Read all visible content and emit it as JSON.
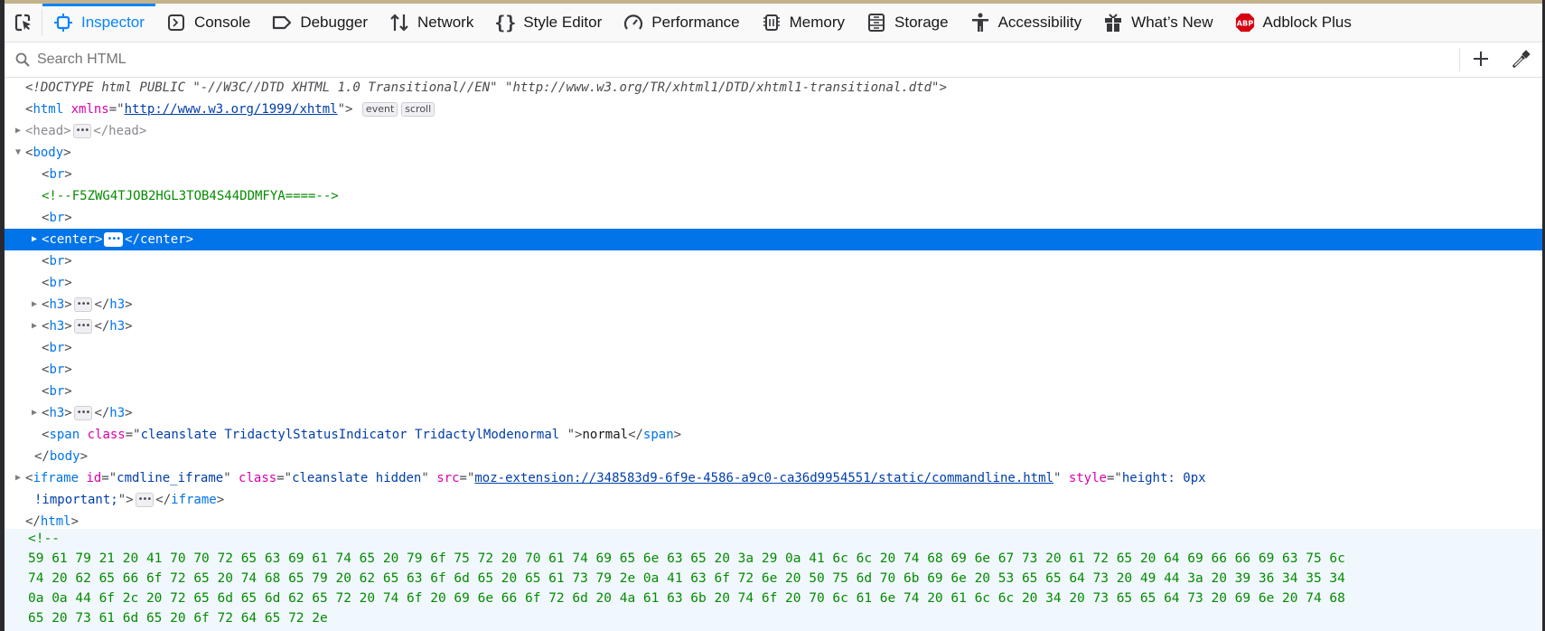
{
  "toolbar": {
    "tabs": [
      {
        "label": "Inspector",
        "icon": "inspector-icon",
        "selected": true
      },
      {
        "label": "Console",
        "icon": "console-icon"
      },
      {
        "label": "Debugger",
        "icon": "debugger-icon"
      },
      {
        "label": "Network",
        "icon": "network-icon"
      },
      {
        "label": "Style Editor",
        "icon": "braces-icon"
      },
      {
        "label": "Performance",
        "icon": "gauge-icon"
      },
      {
        "label": "Memory",
        "icon": "memory-chip-icon"
      },
      {
        "label": "Storage",
        "icon": "storage-icon"
      },
      {
        "label": "Accessibility",
        "icon": "accessibility-icon"
      },
      {
        "label": "What’s New",
        "icon": "gift-icon"
      },
      {
        "label": "Adblock Plus",
        "icon": "abp-icon"
      }
    ],
    "abp_logo_text": "ABP",
    "accent": "#0a84ff"
  },
  "search": {
    "placeholder": "Search HTML"
  },
  "tree": [
    {
      "depth": 0,
      "tokens": [
        [
          "doc",
          "<!DOCTYPE html PUBLIC \"-//W3C//DTD XHTML 1.0 Transitional//EN\" \"http://www.w3.org/TR/xhtml1/DTD/xhtml1-transitional.dtd\">"
        ]
      ]
    },
    {
      "depth": 0,
      "tokens": [
        [
          "p",
          "<"
        ],
        [
          "tag",
          "html"
        ],
        [
          "p",
          " "
        ],
        [
          "attr",
          "xmlns"
        ],
        [
          "p",
          "=\""
        ],
        [
          "link",
          "http://www.w3.org/1999/xhtml"
        ],
        [
          "p",
          "\">"
        ],
        [
          "p",
          " "
        ],
        [
          "badge",
          "event"
        ],
        [
          "badge",
          "scroll"
        ]
      ]
    },
    {
      "depth": 0,
      "expander": "collapsed",
      "tokens": [
        [
          "dim",
          "<head>"
        ],
        [
          "dots",
          "•••"
        ],
        [
          "dim",
          "</head>"
        ]
      ]
    },
    {
      "depth": 0,
      "expander": "expanded",
      "tokens": [
        [
          "p",
          "<"
        ],
        [
          "tag",
          "body"
        ],
        [
          "p",
          ">"
        ]
      ]
    },
    {
      "depth": 1,
      "tokens": [
        [
          "p",
          "<"
        ],
        [
          "tag",
          "br"
        ],
        [
          "p",
          ">"
        ]
      ]
    },
    {
      "depth": 1,
      "tokens": [
        [
          "com",
          "<!--F5ZWG4TJOB2HGL3TOB4S44DDMFYA====-->"
        ]
      ]
    },
    {
      "depth": 1,
      "tokens": [
        [
          "p",
          "<"
        ],
        [
          "tag",
          "br"
        ],
        [
          "p",
          ">"
        ]
      ]
    },
    {
      "depth": 1,
      "expander": "collapsed",
      "selected": true,
      "tokens": [
        [
          "p",
          "<"
        ],
        [
          "tag",
          "center"
        ],
        [
          "p",
          ">"
        ],
        [
          "dots",
          "•••"
        ],
        [
          "p",
          "</"
        ],
        [
          "tag",
          "center"
        ],
        [
          "p",
          ">"
        ]
      ]
    },
    {
      "depth": 1,
      "tokens": [
        [
          "p",
          "<"
        ],
        [
          "tag",
          "br"
        ],
        [
          "p",
          ">"
        ]
      ]
    },
    {
      "depth": 1,
      "tokens": [
        [
          "p",
          "<"
        ],
        [
          "tag",
          "br"
        ],
        [
          "p",
          ">"
        ]
      ]
    },
    {
      "depth": 1,
      "expander": "collapsed",
      "tokens": [
        [
          "p",
          "<"
        ],
        [
          "tag",
          "h3"
        ],
        [
          "p",
          ">"
        ],
        [
          "dots",
          "•••"
        ],
        [
          "p",
          "</"
        ],
        [
          "tag",
          "h3"
        ],
        [
          "p",
          ">"
        ]
      ]
    },
    {
      "depth": 1,
      "expander": "collapsed",
      "tokens": [
        [
          "p",
          "<"
        ],
        [
          "tag",
          "h3"
        ],
        [
          "p",
          ">"
        ],
        [
          "dots",
          "•••"
        ],
        [
          "p",
          "</"
        ],
        [
          "tag",
          "h3"
        ],
        [
          "p",
          ">"
        ]
      ]
    },
    {
      "depth": 1,
      "tokens": [
        [
          "p",
          "<"
        ],
        [
          "tag",
          "br"
        ],
        [
          "p",
          ">"
        ]
      ]
    },
    {
      "depth": 1,
      "tokens": [
        [
          "p",
          "<"
        ],
        [
          "tag",
          "br"
        ],
        [
          "p",
          ">"
        ]
      ]
    },
    {
      "depth": 1,
      "tokens": [
        [
          "p",
          "<"
        ],
        [
          "tag",
          "br"
        ],
        [
          "p",
          ">"
        ]
      ]
    },
    {
      "depth": 1,
      "expander": "collapsed",
      "tokens": [
        [
          "p",
          "<"
        ],
        [
          "tag",
          "h3"
        ],
        [
          "p",
          ">"
        ],
        [
          "dots",
          "•••"
        ],
        [
          "p",
          "</"
        ],
        [
          "tag",
          "h3"
        ],
        [
          "p",
          ">"
        ]
      ]
    },
    {
      "depth": 1,
      "tokens": [
        [
          "p",
          "<"
        ],
        [
          "tag",
          "span"
        ],
        [
          "p",
          " "
        ],
        [
          "attr",
          "class"
        ],
        [
          "p",
          "=\""
        ],
        [
          "val",
          "cleanslate TridactylStatusIndicator TridactylModenormal "
        ],
        [
          "p",
          "\">"
        ],
        [
          "text",
          "normal"
        ],
        [
          "p",
          "</"
        ],
        [
          "tag",
          "span"
        ],
        [
          "p",
          ">"
        ]
      ]
    },
    {
      "depth": 0,
      "indent_extra": true,
      "tokens": [
        [
          "p",
          "</"
        ],
        [
          "tag",
          "body"
        ],
        [
          "p",
          ">"
        ]
      ]
    },
    {
      "depth": 0,
      "expander": "collapsed",
      "tokens": [
        [
          "p",
          "<"
        ],
        [
          "tag",
          "iframe"
        ],
        [
          "p",
          " "
        ],
        [
          "attr",
          "id"
        ],
        [
          "p",
          "=\""
        ],
        [
          "val",
          "cmdline_iframe"
        ],
        [
          "p",
          "\" "
        ],
        [
          "attr",
          "class"
        ],
        [
          "p",
          "=\""
        ],
        [
          "val",
          "cleanslate hidden"
        ],
        [
          "p",
          "\" "
        ],
        [
          "attr",
          "src"
        ],
        [
          "p",
          "=\""
        ],
        [
          "link",
          "moz-extension://348583d9-6f9e-4586-a9c0-ca36d9954551/static/commandline.html"
        ],
        [
          "p",
          "\" "
        ],
        [
          "attr",
          "style"
        ],
        [
          "p",
          "=\""
        ],
        [
          "val",
          "height: 0px"
        ]
      ]
    },
    {
      "depth": 0,
      "continuation": true,
      "tokens": [
        [
          "val",
          "!important;"
        ],
        [
          "p",
          "\">"
        ],
        [
          "dots",
          "•••"
        ],
        [
          "p",
          "</"
        ],
        [
          "tag",
          "iframe"
        ],
        [
          "p",
          ">"
        ]
      ]
    },
    {
      "depth": 0,
      "tokens": [
        [
          "p",
          "</"
        ],
        [
          "tag",
          "html"
        ],
        [
          "p",
          ">"
        ]
      ]
    }
  ],
  "hex_comment": {
    "open": "<!--",
    "lines": [
      "59 61 79 21 20 41 70 70 72 65 63 69 61 74 65 20 79 6f 75 72 20 70 61 74 69 65 6e 63 65 20 3a 29 0a 41 6c 6c 20 74 68 69 6e 67 73 20 61 72 65 20 64 69 66 66 69 63 75 6c",
      "74 20 62 65 66 6f 72 65 20 74 68 65 79 20 62 65 63 6f 6d 65 20 65 61 73 79 2e 0a 41 63 6f 72 6e 20 50 75 6d 70 6b 69 6e 20 53 65 65 64 73 20 49 44 3a 20 39 36 34 35 34",
      "0a 0a 44 6f 2c 20 72 65 6d 65 6d 62 65 72 20 74 6f 20 69 6e 66 6f 72 6d 20 4a 61 63 6b 20 74 6f 20 70 6c 61 6e 74 20 61 6c 6c 20 34 20 73 65 65 64 73 20 69 6e 20 74 68",
      "65 20 73 61 6d 65 20 6f 72 64 65 72 2e"
    ]
  }
}
